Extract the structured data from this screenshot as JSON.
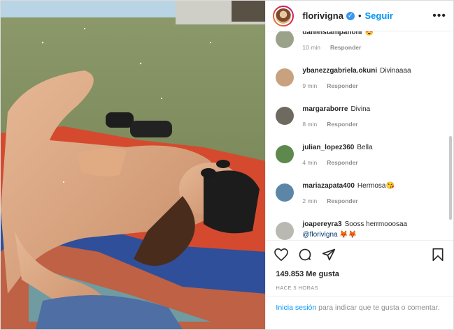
{
  "header": {
    "username": "florivigna",
    "separator": "•",
    "follow_label": "Seguir",
    "more_label": "•••"
  },
  "comments": [
    {
      "username": "danielstampanoni",
      "text": "😍",
      "time": "10 min",
      "reply": "Responder",
      "avatar_color": "#9aa38a"
    },
    {
      "username": "ybanezzgabriela.okuni",
      "text": "Divinaaaa",
      "time": "9 min",
      "reply": "Responder",
      "avatar_color": "#c8a27e"
    },
    {
      "username": "margaraborre",
      "text": "Divina",
      "time": "8 min",
      "reply": "Responder",
      "avatar_color": "#6f6a60"
    },
    {
      "username": "julian_lopez360",
      "text": "Bella",
      "time": "4 min",
      "reply": "Responder",
      "avatar_color": "#5d8a4c"
    },
    {
      "username": "mariazapata400",
      "text": "Hermosa😘",
      "time": "2 min",
      "reply": "Responder",
      "avatar_color": "#5b86a8"
    },
    {
      "username": "joapereyra3",
      "text": "Sooss herrmooosaa",
      "mention": "@florivigna",
      "mention_tail": " 🦊🦊",
      "avatar_color": "#b9b9b2"
    }
  ],
  "likes": {
    "count": "149.853",
    "label": "Me gusta"
  },
  "timestamp": "HACE 5 HORAS",
  "login_prompt": {
    "link": "Inicia sesión",
    "text": " para indicar que te gusta o comentar."
  },
  "colors": {
    "accent": "#0095f6",
    "verified": "#3897f0",
    "muted": "#8e8e8e"
  },
  "icons": [
    "heart-icon",
    "comment-icon",
    "share-icon",
    "bookmark-icon",
    "verified-icon",
    "more-icon"
  ]
}
